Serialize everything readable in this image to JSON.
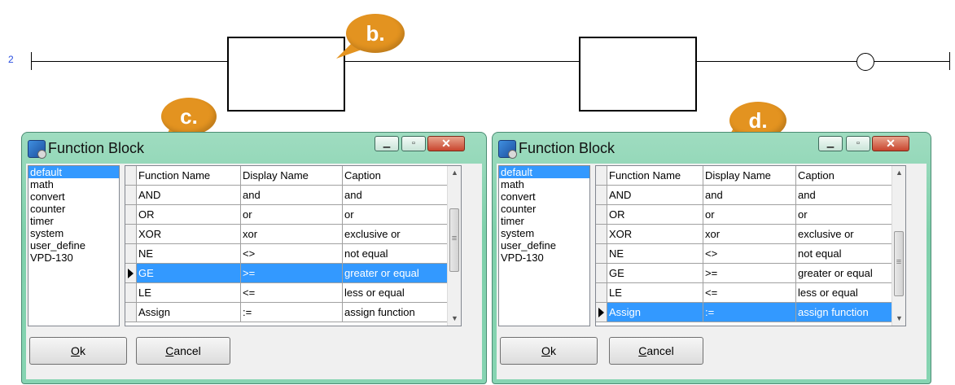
{
  "ladder": {
    "rung_number": "2"
  },
  "callouts": {
    "b": "b.",
    "c": "c.",
    "d": "d."
  },
  "colors": {
    "callout": "#e39320",
    "selection": "#3399ff",
    "dialog_frame": "#86d4b2",
    "rung_number": "#2a4ee0"
  },
  "dialogs": [
    {
      "title": "Function Block",
      "icon": "function-block-app-icon",
      "categories": [
        {
          "label": "default",
          "selected": true
        },
        {
          "label": "math",
          "selected": false
        },
        {
          "label": "convert",
          "selected": false
        },
        {
          "label": "counter",
          "selected": false
        },
        {
          "label": "timer",
          "selected": false
        },
        {
          "label": "system",
          "selected": false
        },
        {
          "label": "user_define",
          "selected": false
        },
        {
          "label": "VPD-130",
          "selected": false
        }
      ],
      "columns": [
        "Function Name",
        "Display Name",
        "Caption"
      ],
      "rows": [
        {
          "function": "AND",
          "display": "and",
          "caption": "and"
        },
        {
          "function": "OR",
          "display": "or",
          "caption": "or"
        },
        {
          "function": "XOR",
          "display": "xor",
          "caption": "exclusive or"
        },
        {
          "function": "NE",
          "display": "<>",
          "caption": "not equal"
        },
        {
          "function": "GE",
          "display": ">=",
          "caption": "greater or equal"
        },
        {
          "function": "LE",
          "display": "<=",
          "caption": "less or equal"
        },
        {
          "function": "Assign",
          "display": ":=",
          "caption": "assign function"
        }
      ],
      "selected_row": 4,
      "ok_label": "Ok",
      "cancel_label": "Cancel",
      "window_buttons": [
        "minimize",
        "maximize",
        "close"
      ]
    },
    {
      "title": "Function Block",
      "icon": "function-block-app-icon",
      "categories": [
        {
          "label": "default",
          "selected": true
        },
        {
          "label": "math",
          "selected": false
        },
        {
          "label": "convert",
          "selected": false
        },
        {
          "label": "counter",
          "selected": false
        },
        {
          "label": "timer",
          "selected": false
        },
        {
          "label": "system",
          "selected": false
        },
        {
          "label": "user_define",
          "selected": false
        },
        {
          "label": "VPD-130",
          "selected": false
        }
      ],
      "columns": [
        "Function Name",
        "Display Name",
        "Caption"
      ],
      "rows": [
        {
          "function": "AND",
          "display": "and",
          "caption": "and"
        },
        {
          "function": "OR",
          "display": "or",
          "caption": "or"
        },
        {
          "function": "XOR",
          "display": "xor",
          "caption": "exclusive or"
        },
        {
          "function": "NE",
          "display": "<>",
          "caption": "not equal"
        },
        {
          "function": "GE",
          "display": ">=",
          "caption": "greater or equal"
        },
        {
          "function": "LE",
          "display": "<=",
          "caption": "less or equal"
        },
        {
          "function": "Assign",
          "display": ":=",
          "caption": "assign function"
        }
      ],
      "selected_row": 6,
      "ok_label": "Ok",
      "cancel_label": "Cancel",
      "window_buttons": [
        "minimize",
        "maximize",
        "close"
      ]
    }
  ]
}
